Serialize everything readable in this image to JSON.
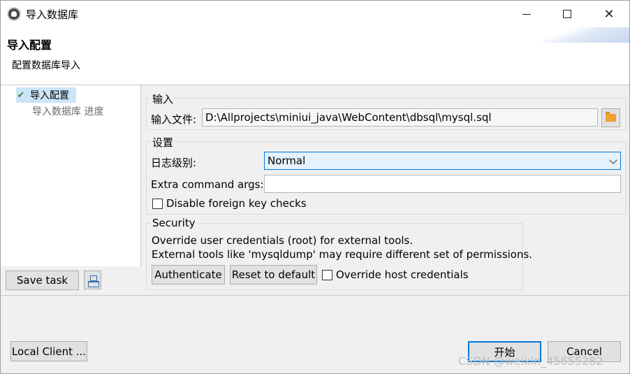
{
  "window": {
    "title": "导入数据库"
  },
  "header": {
    "title": "导入配置",
    "subtitle": "配置数据库导入"
  },
  "nav": {
    "items": [
      {
        "label": "导入配置",
        "selected": true
      },
      {
        "label": "导入数据库 进度",
        "selected": false
      }
    ]
  },
  "left_buttons": {
    "save_task": "Save task"
  },
  "input_group": {
    "label": "输入",
    "file_label": "输入文件:",
    "file_value": "D:\\Allprojects\\miniui_java\\WebContent\\dbsql\\mysql.sql"
  },
  "settings_group": {
    "label": "设置",
    "log_level_label": "日志级别:",
    "log_level_value": "Normal",
    "extra_args_label": "Extra command args:",
    "extra_args_value": "",
    "disable_fk_label": "Disable foreign key checks",
    "disable_fk_checked": false
  },
  "security_group": {
    "label": "Security",
    "line1": "Override user credentials (root) for external tools.",
    "line2": "External tools like 'mysqldump' may require different set of permissions.",
    "authenticate": "Authenticate",
    "reset": "Reset to default",
    "override_host_label": "Override host credentials",
    "override_host_checked": false
  },
  "footer": {
    "local_client": "Local Client ...",
    "start": "开始",
    "cancel": "Cancel"
  },
  "watermark": "CSDN @weixin_45655282",
  "colors": {
    "accent": "#0078d7",
    "selection": "#cce4f7",
    "folder": "#f0a030"
  }
}
